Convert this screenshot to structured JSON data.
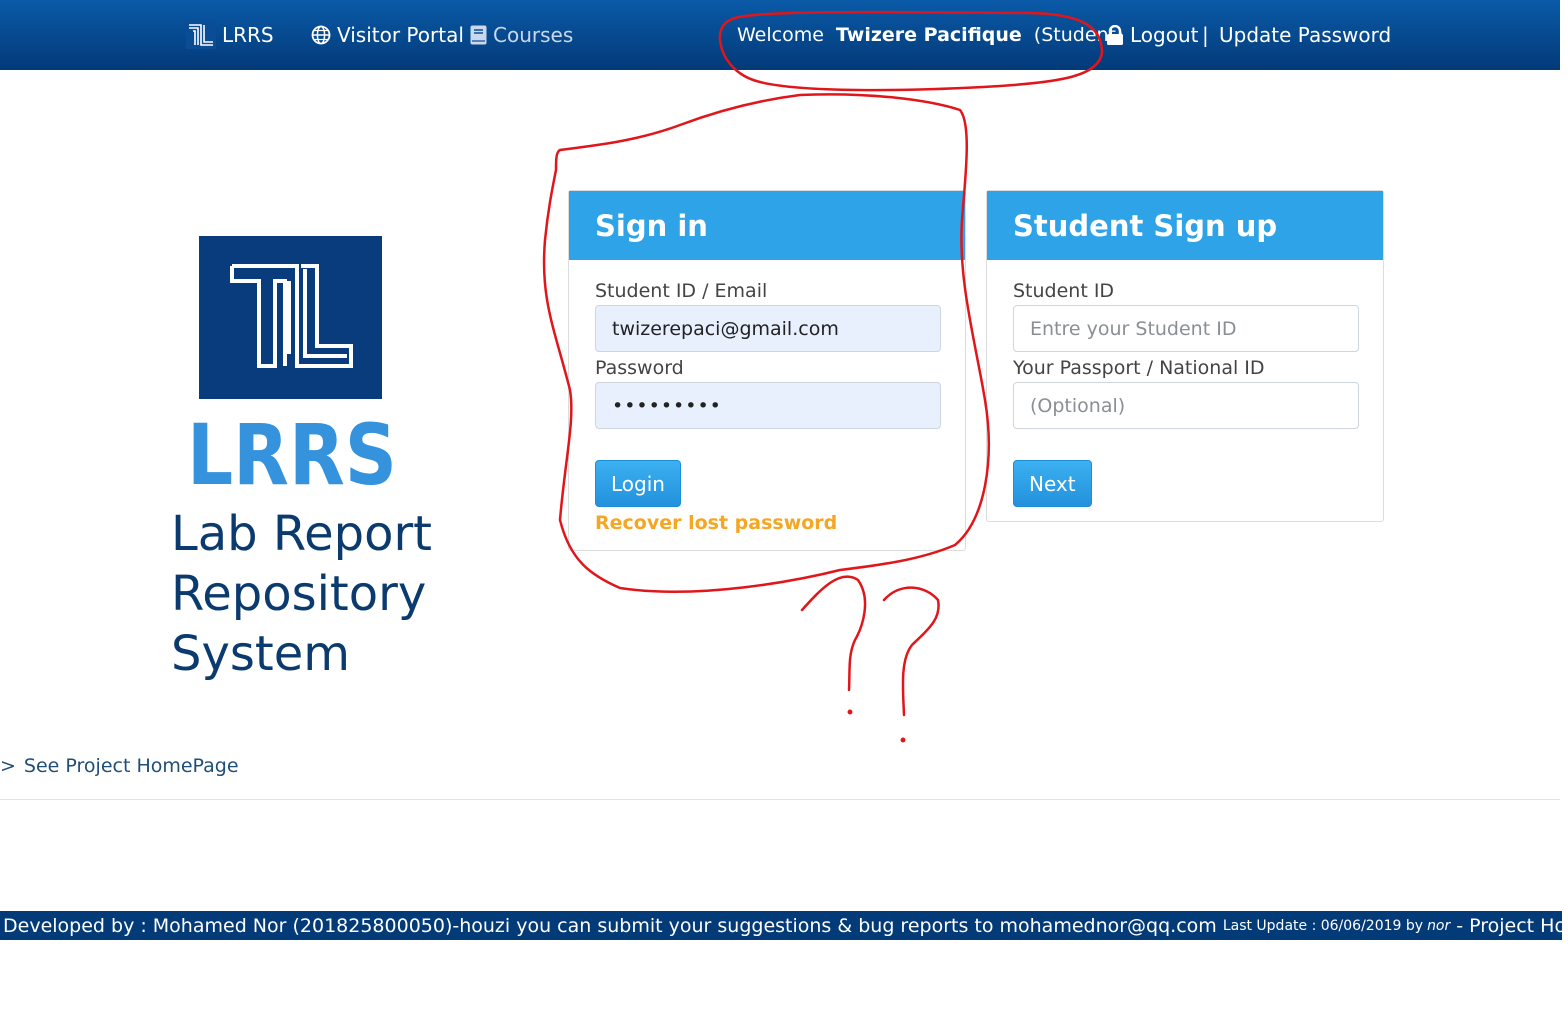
{
  "nav": {
    "brand": "LRRS",
    "visitor_portal": "Visitor Portal",
    "courses": "Courses",
    "welcome": "Welcome",
    "user_name": "Twizere Pacifique",
    "role": "(Student)",
    "logout": "Logout",
    "separator": "|",
    "update_password": "Update Password"
  },
  "brand": {
    "logo_text": "LRRS",
    "title_lines": [
      "Lab Report",
      "Repository",
      "System"
    ]
  },
  "signin": {
    "title": "Sign in",
    "id_label": "Student ID / Email",
    "id_value": "twizerepaci@gmail.com",
    "password_label": "Password",
    "password_value": "•••••••••",
    "login_button": "Login",
    "recover_link": "Recover lost password"
  },
  "signup": {
    "title": "Student Sign up",
    "id_label": "Student ID",
    "id_placeholder": "Entre your Student ID",
    "passport_label": "Your Passport / National ID",
    "passport_placeholder": "(Optional)",
    "next_button": "Next"
  },
  "home_link": {
    "arrow": ">",
    "label": "See Project HomePage"
  },
  "footer": {
    "developed_by": "Developed by : Mohamed Nor (201825800050)-houzi you can submit your suggestions & bug reports to mohamednor@qq.com",
    "last_update": "Last Update : 06/06/2019 by",
    "author": "nor",
    "dash": "-",
    "project_home": "Project Home Page"
  },
  "colors": {
    "navbar": "#033a78",
    "panel_header": "#2ea3e8",
    "brand_blue": "#083c7d",
    "logo_light_blue": "#3592dd",
    "recover_link": "#f5a623",
    "annotation_red": "#e0161b"
  }
}
